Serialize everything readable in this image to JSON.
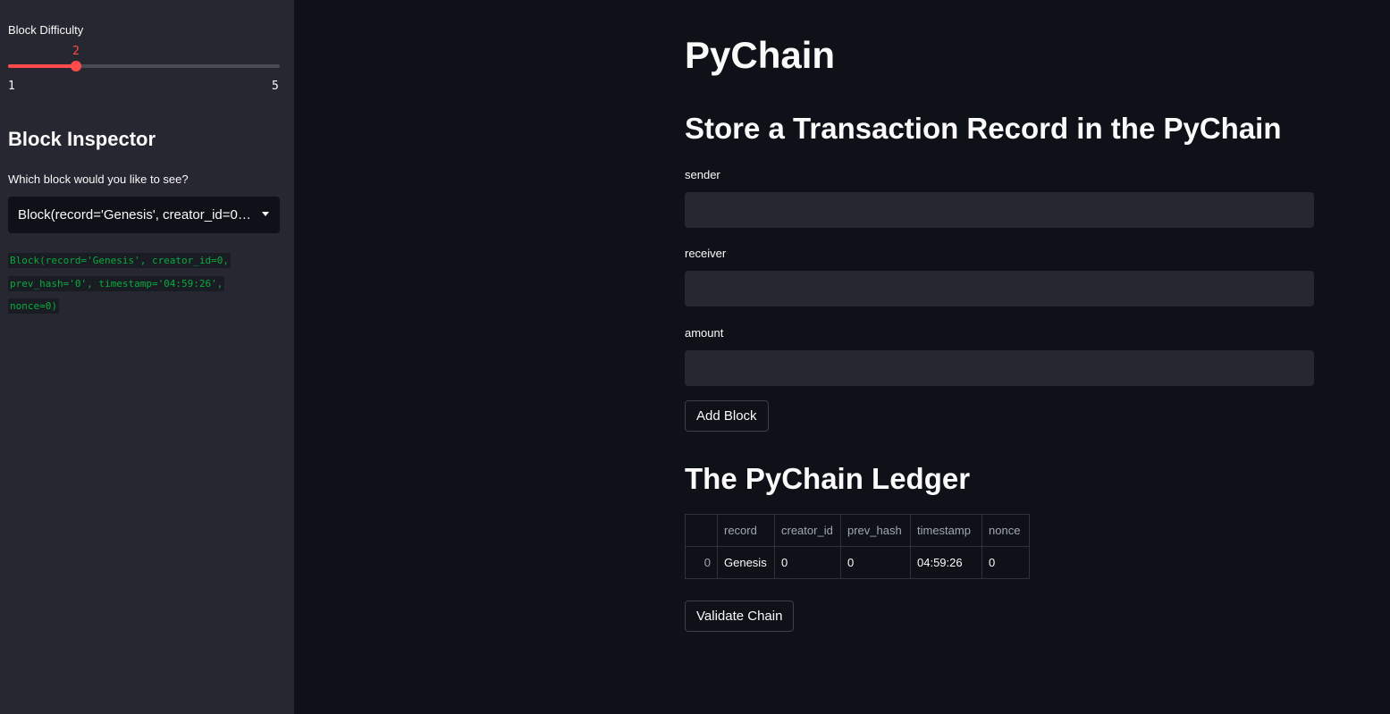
{
  "sidebar": {
    "slider": {
      "label": "Block Difficulty",
      "value": "2",
      "min": "1",
      "max": "5",
      "fraction": 0.25,
      "accent_color": "#ff4b4b"
    },
    "heading": "Block Inspector",
    "select": {
      "label": "Which block would you like to see?",
      "selected": "Block(record='Genesis', creator_id=0, prev_hash='0', timestamp='04:59:26', nonce=0)"
    },
    "code_lines": [
      "Block(record='Genesis', creator_id=0,",
      "prev_hash='0', timestamp='04:59:26',",
      "nonce=0)"
    ]
  },
  "main": {
    "title": "PyChain",
    "form_heading": "Store a Transaction Record in the PyChain",
    "fields": {
      "sender_label": "sender",
      "sender_value": "",
      "receiver_label": "receiver",
      "receiver_value": "",
      "amount_label": "amount",
      "amount_value": ""
    },
    "add_block_label": "Add Block",
    "ledger_heading": "The PyChain Ledger",
    "ledger": {
      "columns": [
        "",
        "record",
        "creator_id",
        "prev_hash",
        "timestamp",
        "nonce"
      ],
      "rows": [
        [
          "0",
          "Genesis",
          "0",
          "0",
          "04:59:26",
          "0"
        ]
      ]
    },
    "validate_label": "Validate Chain"
  }
}
